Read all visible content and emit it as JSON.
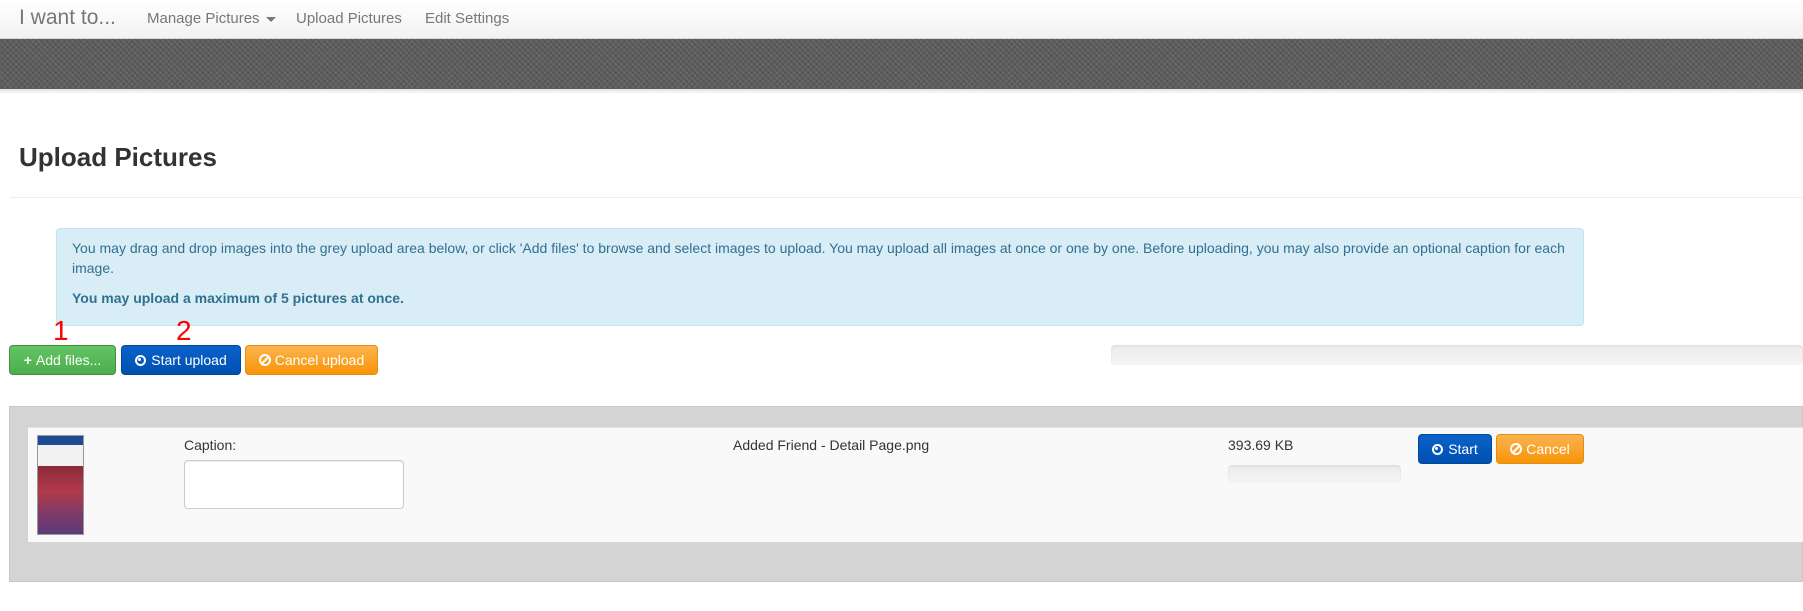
{
  "navbar": {
    "brand": "I want to...",
    "items": [
      {
        "label": "Manage Pictures",
        "dropdown": true
      },
      {
        "label": "Upload Pictures"
      },
      {
        "label": "Edit Settings"
      }
    ]
  },
  "page": {
    "title": "Upload Pictures"
  },
  "alert": {
    "message": "You may drag and drop images into the grey upload area below, or click 'Add files' to browse and select images to upload. You may upload all images at once or one by one. Before uploading, you may also provide an optional caption for each image.",
    "limit": "You may upload a maximum of 5 pictures at once."
  },
  "annotations": [
    "1",
    "2"
  ],
  "toolbar": {
    "add_files": "Add files...",
    "start_upload": "Start upload",
    "cancel_upload": "Cancel upload"
  },
  "file": {
    "caption_label": "Caption:",
    "caption_value": "",
    "name": "Added Friend - Detail Page.png",
    "size": "393.69 KB",
    "start": "Start",
    "cancel": "Cancel"
  },
  "colors": {
    "success": "#5cb85c",
    "primary": "#0057bd",
    "warning": "#f89406",
    "info_bg": "#d9edf7",
    "info_text": "#31708f",
    "annotation": "#ff0000"
  },
  "icons": {
    "add": "plus-icon",
    "start": "circle-arrow-up-icon",
    "cancel": "ban-circle-icon"
  }
}
